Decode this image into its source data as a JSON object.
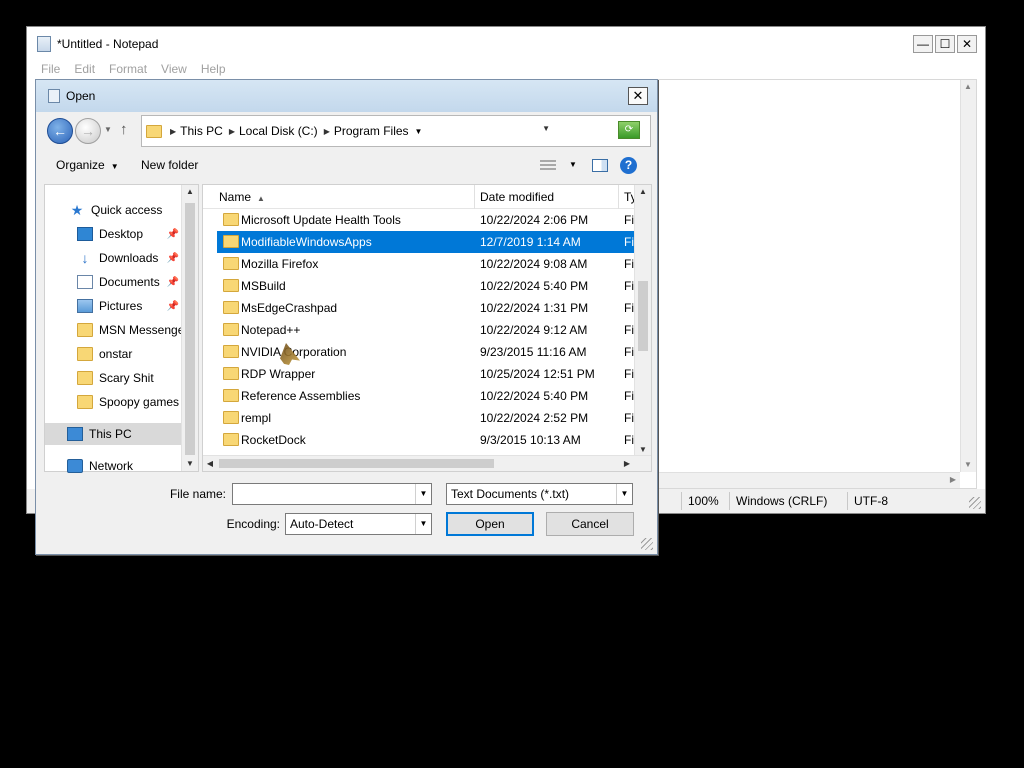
{
  "notepad": {
    "title": "*Untitled - Notepad",
    "menu": [
      "File",
      "Edit",
      "Format",
      "View",
      "Help"
    ],
    "window_buttons": {
      "minimize": "—",
      "maximize": "☐",
      "close": "✕"
    },
    "status": {
      "zoom": "100%",
      "line_ending": "Windows (CRLF)",
      "encoding": "UTF-8"
    }
  },
  "dialog": {
    "title": "Open",
    "close_glyph": "✕",
    "breadcrumbs": [
      "This PC",
      "Local Disk (C:)",
      "Program Files"
    ],
    "toolbar": {
      "organize": "Organize",
      "new_folder": "New folder",
      "help_glyph": "?"
    },
    "nav": [
      {
        "label": "Quick access",
        "icon": "star-icon"
      },
      {
        "label": "Desktop",
        "icon": "desktop-icon",
        "pinned": true
      },
      {
        "label": "Downloads",
        "icon": "downloads-icon",
        "pinned": true
      },
      {
        "label": "Documents",
        "icon": "documents-icon",
        "pinned": true
      },
      {
        "label": "Pictures",
        "icon": "pictures-icon",
        "pinned": true
      },
      {
        "label": "MSN Messenger",
        "icon": "folder-icon"
      },
      {
        "label": "onstar",
        "icon": "folder-icon"
      },
      {
        "label": "Scary Shit",
        "icon": "folder-icon"
      },
      {
        "label": "Spoopy games",
        "icon": "folder-icon"
      },
      {
        "label": "This PC",
        "icon": "this-pc-icon",
        "selected": true
      },
      {
        "label": "Network",
        "icon": "network-icon"
      }
    ],
    "columns": {
      "name": "Name",
      "date_modified": "Date modified",
      "type": "Ty"
    },
    "files": [
      {
        "name": "Microsoft Update Health Tools",
        "date": "10/22/2024 2:06 PM",
        "type": "Fi"
      },
      {
        "name": "ModifiableWindowsApps",
        "date": "12/7/2019 1:14 AM",
        "type": "Fi",
        "selected": true
      },
      {
        "name": "Mozilla Firefox",
        "date": "10/22/2024 9:08 AM",
        "type": "Fi"
      },
      {
        "name": "MSBuild",
        "date": "10/22/2024 5:40 PM",
        "type": "Fi"
      },
      {
        "name": "MsEdgeCrashpad",
        "date": "10/22/2024 1:31 PM",
        "type": "Fi"
      },
      {
        "name": "Notepad++",
        "date": "10/22/2024 9:12 AM",
        "type": "Fi"
      },
      {
        "name": "NVIDIA Corporation",
        "date": "9/23/2015 11:16 AM",
        "type": "Fi"
      },
      {
        "name": "RDP Wrapper",
        "date": "10/25/2024 12:51 PM",
        "type": "Fi"
      },
      {
        "name": "Reference Assemblies",
        "date": "10/22/2024 5:40 PM",
        "type": "Fi"
      },
      {
        "name": "rempl",
        "date": "10/22/2024 2:52 PM",
        "type": "Fi"
      },
      {
        "name": "RocketDock",
        "date": "9/3/2015 10:13 AM",
        "type": "Fi"
      }
    ],
    "file_name_label": "File name:",
    "file_name_value": "",
    "file_type_value": "Text Documents (*.txt)",
    "encoding_label": "Encoding:",
    "encoding_value": "Auto-Detect",
    "open_label": "Open",
    "cancel_label": "Cancel"
  }
}
